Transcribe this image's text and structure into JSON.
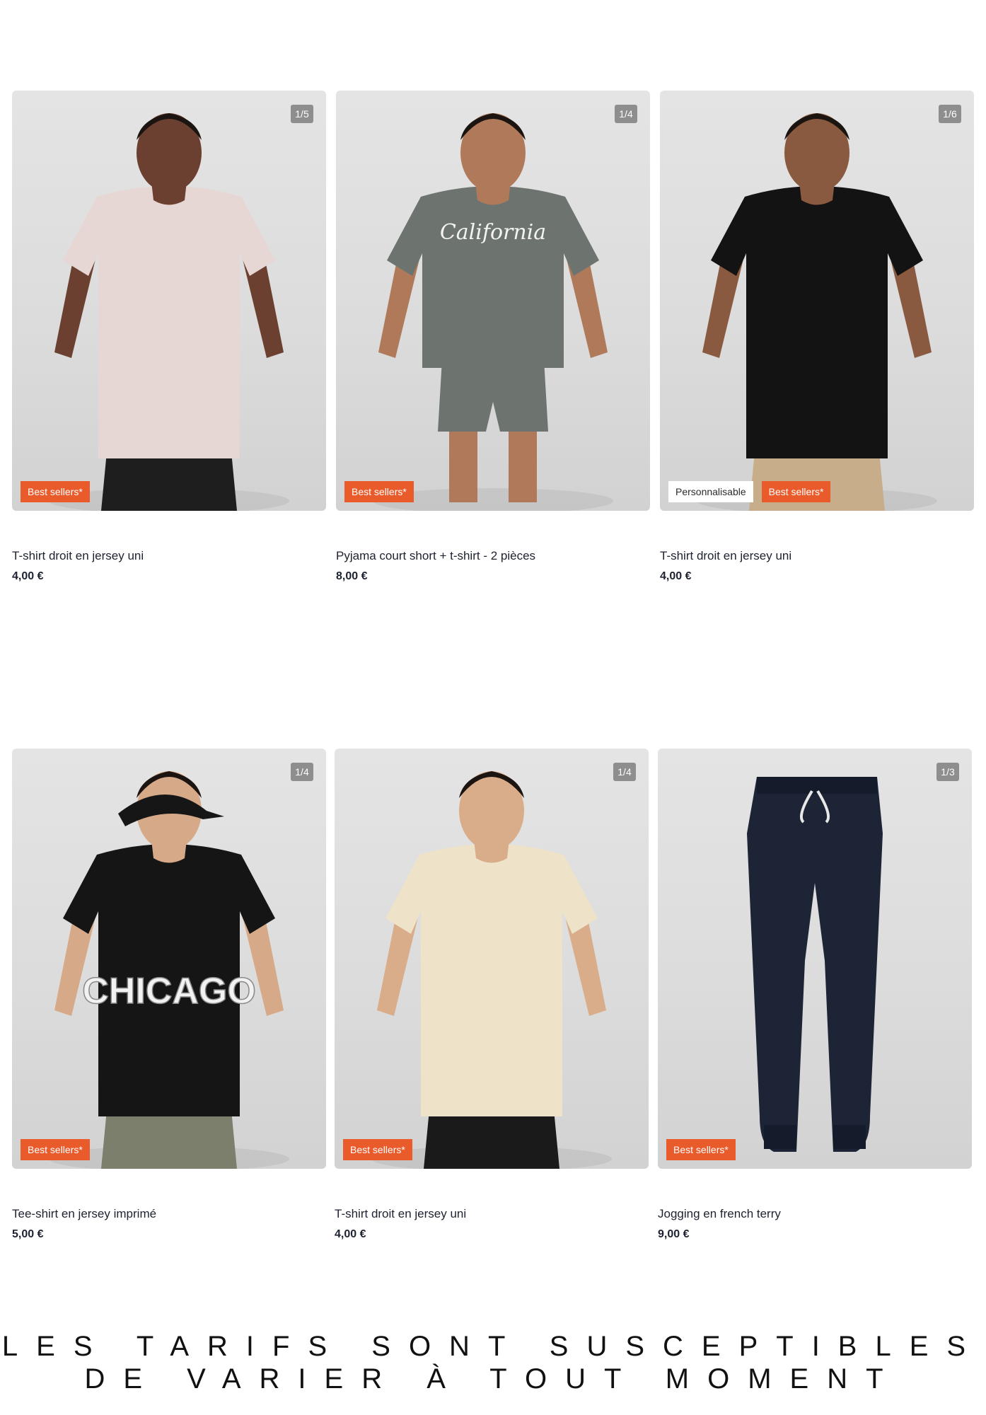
{
  "products": [
    {
      "name": "T-shirt droit en jersey uni",
      "price": "4,00 €",
      "image_counter": "1/5",
      "badges": [
        "Best sellers*"
      ],
      "figure": {
        "type": "tshirt",
        "shirt_color": "#e6d6d4",
        "skin": "#6b4030",
        "bottom_color": "#1e1e1e"
      }
    },
    {
      "name": "Pyjama court short + t-shirt - 2 pièces",
      "price": "8,00 €",
      "image_counter": "1/4",
      "badges": [
        "Best sellers*"
      ],
      "figure": {
        "type": "pyjama",
        "shirt_color": "#6d746f",
        "skin": "#b07a5a",
        "bottom_color": "#6d746f",
        "print": "California"
      }
    },
    {
      "name": "T-shirt droit en jersey uni",
      "price": "4,00 €",
      "image_counter": "1/6",
      "badges": [
        "Personnalisable",
        "Best sellers*"
      ],
      "figure": {
        "type": "tshirt",
        "shirt_color": "#131313",
        "skin": "#8a5a40",
        "bottom_color": "#c8ad8b"
      }
    },
    {
      "name": "Tee-shirt en jersey imprimé",
      "price": "5,00 €",
      "image_counter": "1/4",
      "badges": [
        "Best sellers*"
      ],
      "figure": {
        "type": "tshirt-cap",
        "shirt_color": "#151515",
        "skin": "#d6a988",
        "bottom_color": "#7d7f6d",
        "print": "CHICAGO"
      }
    },
    {
      "name": "T-shirt droit en jersey uni",
      "price": "4,00 €",
      "image_counter": "1/4",
      "badges": [
        "Best sellers*"
      ],
      "figure": {
        "type": "tshirt",
        "shirt_color": "#eee2c8",
        "skin": "#d9ad8a",
        "bottom_color": "#1a1a1a"
      }
    },
    {
      "name": "Jogging en french terry",
      "price": "9,00 €",
      "image_counter": "1/3",
      "badges": [
        "Best sellers*"
      ],
      "figure": {
        "type": "pants",
        "pants_color": "#1c2436"
      }
    }
  ],
  "footer_note": "Les tarifs sont susceptibles de varier à tout moment",
  "colors": {
    "badge_orange": "#ea5b2b",
    "counter_grey": "#8e8e8e",
    "text_dark": "#1d2230"
  }
}
